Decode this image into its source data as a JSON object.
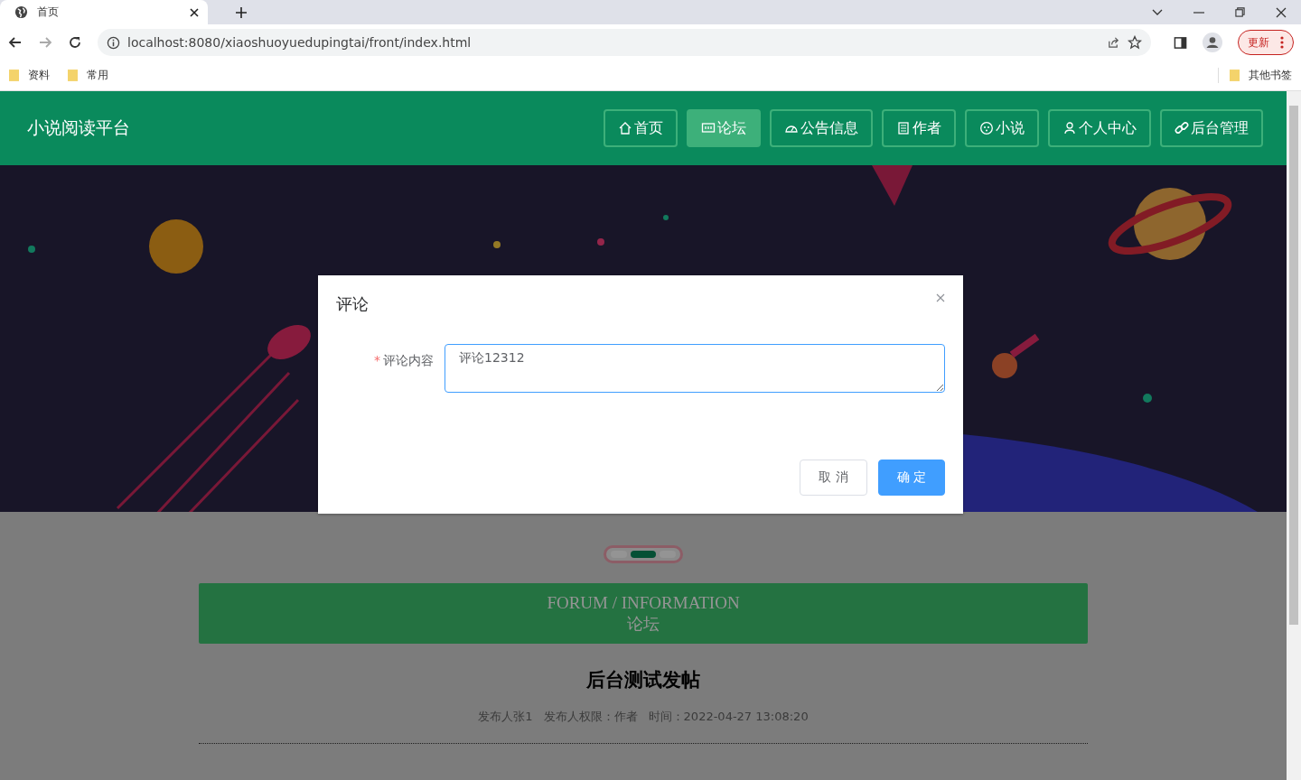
{
  "browser": {
    "tab_title": "首页",
    "url": "localhost:8080/xiaoshuoyuedupingtai/front/index.html",
    "bookmarks": [
      "资料",
      "常用"
    ],
    "other_bookmarks": "其他书签",
    "update_button": "更新"
  },
  "site": {
    "title": "小说阅读平台"
  },
  "nav": [
    {
      "label": "首页",
      "kind": "home",
      "selected": false
    },
    {
      "label": "论坛",
      "kind": "chat",
      "selected": true
    },
    {
      "label": "公告信息",
      "kind": "gauge",
      "selected": false
    },
    {
      "label": "作者",
      "kind": "doc",
      "selected": false
    },
    {
      "label": "小说",
      "kind": "smile",
      "selected": false
    },
    {
      "label": "个人中心",
      "kind": "user",
      "selected": false
    },
    {
      "label": "后台管理",
      "kind": "link",
      "selected": false
    }
  ],
  "carousel": {
    "indicators": [
      {
        "selected": false
      },
      {
        "selected": true
      },
      {
        "selected": false
      }
    ]
  },
  "section": {
    "title_en": "FORUM / INFORMATION",
    "title_zh": "论坛"
  },
  "post": {
    "title": "后台测试发帖",
    "meta": [
      "发布人张1",
      "发布人权限：作者",
      "时间：2022-04-27 13:08:20"
    ]
  },
  "dialog": {
    "title": "评论",
    "field": {
      "label": "评论内容",
      "required": true,
      "required_mark": "*",
      "value": "评论12312"
    },
    "buttons": [
      {
        "label": "取 消",
        "kind": "default"
      },
      {
        "label": "确 定",
        "kind": "primary"
      }
    ]
  }
}
